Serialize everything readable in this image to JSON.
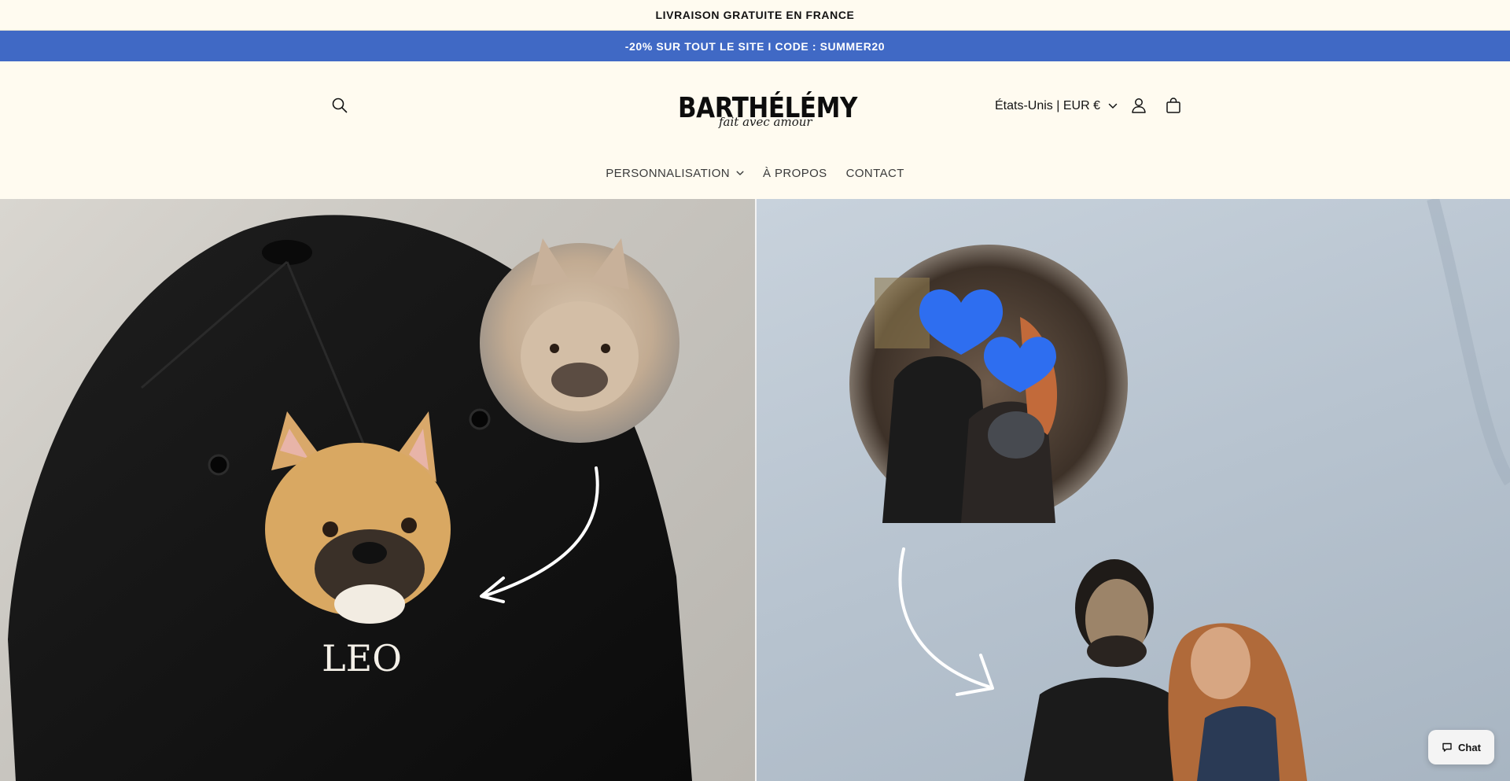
{
  "announcements": {
    "top": "LIVRAISON GRATUITE EN FRANCE",
    "promo": "-20% SUR TOUT LE SITE I CODE : SUMMER20"
  },
  "header": {
    "logo_main": "BARTHÉLÉMY",
    "logo_tagline": "fait avec amour",
    "currency_selector": "États-Unis | EUR €",
    "icons": [
      "search-icon",
      "account-icon",
      "cart-icon",
      "chevron-down-icon"
    ]
  },
  "nav": {
    "items": [
      {
        "label": "PERSONNALISATION",
        "has_dropdown": true
      },
      {
        "label": "À PROPOS",
        "has_dropdown": false
      },
      {
        "label": "CONTACT",
        "has_dropdown": false
      }
    ]
  },
  "hero": {
    "left_embroidery_name": "LEO"
  },
  "chat": {
    "label": "Chat"
  },
  "colors": {
    "background": "#fffbf0",
    "promo_bar": "#4069c5",
    "text": "#121212"
  }
}
